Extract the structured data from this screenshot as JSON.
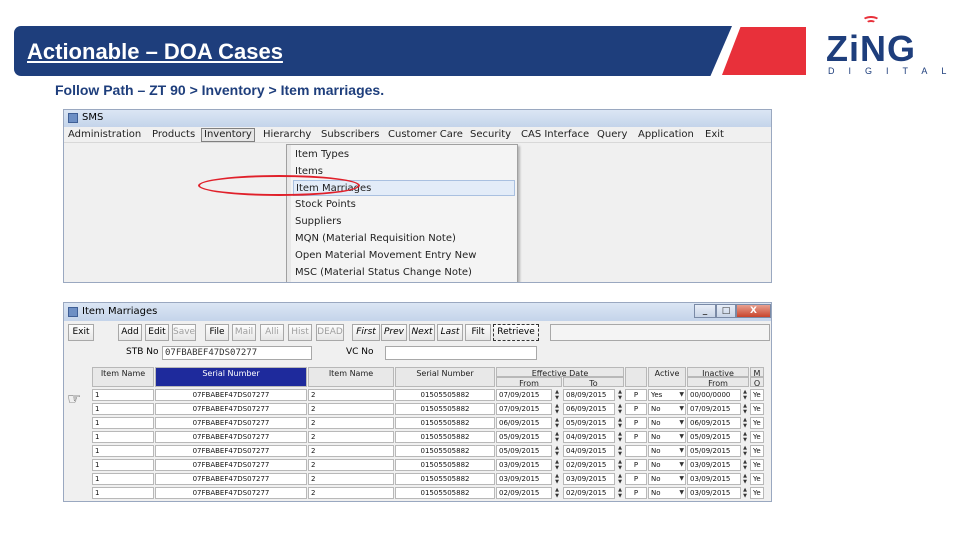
{
  "slide": {
    "title": "Actionable – DOA Cases",
    "path_instruction": "Follow Path – ZT 90 > Inventory > Item marriages.",
    "brand": {
      "logo_word": "ZiNG",
      "logo_sub": "DIGITAL",
      "primary": "#1e3e7c",
      "accent": "#e8303a"
    }
  },
  "sms_window": {
    "title": "SMS",
    "menu": [
      "Administration",
      "Products",
      "Inventory",
      "Hierarchy",
      "Subscribers",
      "Customer Care",
      "Security",
      "CAS Interface",
      "Query",
      "Application",
      "Exit"
    ],
    "open_menu": "Inventory",
    "dropdown": [
      "Item Types",
      "Items",
      "Item Marriages",
      "Stock Points",
      "Suppliers",
      "MQN (Material Requisition Note)",
      "Open Material Movement Entry New",
      "MSC (Material Status Change Note)"
    ],
    "highlighted_item": "Item Marriages"
  },
  "item_marriages_window": {
    "title": "Item Marriages",
    "controls": {
      "minimize": "_",
      "restore": "□",
      "close": "X"
    },
    "toolbar": [
      "Exit",
      "Add",
      "Edit",
      "Save",
      "File",
      "Mail",
      "Alli",
      "Hist",
      "DEAD",
      "First",
      "Prev",
      "Next",
      "Last",
      "Filt",
      "Retrieve"
    ],
    "disabled": [
      "Save",
      "Mail",
      "Alli",
      "Hist",
      "DEAD"
    ],
    "focused": "Retrieve",
    "stb_label": "STB No",
    "stb_value": "07FBABEF47DS07277",
    "vc_label": "VC No",
    "vc_value": "",
    "columns": {
      "item_name_1": "Item Name",
      "serial_number_1": "Serial Number",
      "item_name_2": "Item Name",
      "serial_number_2": "Serial Number",
      "effective_date": "Effective Date",
      "from": "From",
      "to": "To",
      "p": "",
      "active": "Active",
      "inactive": "Inactive",
      "inactive_from": "From",
      "m": "M",
      "m_sub": "O"
    },
    "rows": [
      {
        "item1": "1",
        "serial1": "07FBABEF47DS07277",
        "item2": "2",
        "serial2": "01505505882",
        "from": "07/09/2015",
        "to": "08/09/2015",
        "p": "P",
        "active": "Yes",
        "inactive_from": "00/00/0000",
        "m": "Ye"
      },
      {
        "item1": "1",
        "serial1": "07FBABEF47DS07277",
        "item2": "2",
        "serial2": "01505505882",
        "from": "07/09/2015",
        "to": "06/09/2015",
        "p": "P",
        "active": "No",
        "inactive_from": "07/09/2015",
        "m": "Ye"
      },
      {
        "item1": "1",
        "serial1": "07FBABEF47DS07277",
        "item2": "2",
        "serial2": "01505505882",
        "from": "06/09/2015",
        "to": "05/09/2015",
        "p": "P",
        "active": "No",
        "inactive_from": "06/09/2015",
        "m": "Ye"
      },
      {
        "item1": "1",
        "serial1": "07FBABEF47DS07277",
        "item2": "2",
        "serial2": "01505505882",
        "from": "05/09/2015",
        "to": "04/09/2015",
        "p": "P",
        "active": "No",
        "inactive_from": "05/09/2015",
        "m": "Ye"
      },
      {
        "item1": "1",
        "serial1": "07FBABEF47DS07277",
        "item2": "2",
        "serial2": "01505505882",
        "from": "05/09/2015",
        "to": "04/09/2015",
        "p": "",
        "active": "No",
        "inactive_from": "05/09/2015",
        "m": "Ye"
      },
      {
        "item1": "1",
        "serial1": "07FBABEF47DS07277",
        "item2": "2",
        "serial2": "01505505882",
        "from": "03/09/2015",
        "to": "02/09/2015",
        "p": "P",
        "active": "No",
        "inactive_from": "03/09/2015",
        "m": "Ye"
      },
      {
        "item1": "1",
        "serial1": "07FBABEF47DS07277",
        "item2": "2",
        "serial2": "01505505882",
        "from": "03/09/2015",
        "to": "03/09/2015",
        "p": "P",
        "active": "No",
        "inactive_from": "03/09/2015",
        "m": "Ye"
      },
      {
        "item1": "1",
        "serial1": "07FBABEF47DS07277",
        "item2": "2",
        "serial2": "01505505882",
        "from": "02/09/2015",
        "to": "02/09/2015",
        "p": "P",
        "active": "No",
        "inactive_from": "03/09/2015",
        "m": "Ye"
      }
    ]
  }
}
